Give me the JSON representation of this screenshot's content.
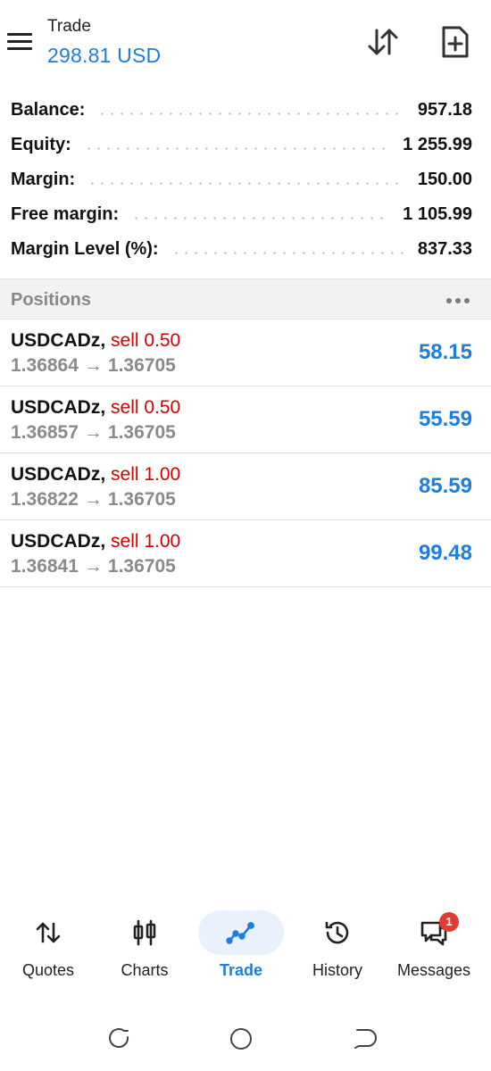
{
  "header": {
    "title": "Trade",
    "subtitle": "298.81 USD",
    "menu_icon": "hamburger-menu-icon",
    "sort_icon": "sort-arrows-icon",
    "new_order_icon": "new-order-document-icon"
  },
  "summary": [
    {
      "label": "Balance:",
      "value": "957.18"
    },
    {
      "label": "Equity:",
      "value": "1 255.99"
    },
    {
      "label": "Margin:",
      "value": "150.00"
    },
    {
      "label": "Free margin:",
      "value": "1 105.99"
    },
    {
      "label": "Margin Level (%):",
      "value": "837.33"
    }
  ],
  "positions": {
    "title": "Positions",
    "more_icon": "more-dots-icon",
    "items": [
      {
        "symbol": "USDCADz",
        "side": "sell 0.50",
        "open": "1.36864",
        "arrow": "→",
        "current": "1.36705",
        "profit": "58.15"
      },
      {
        "symbol": "USDCADz",
        "side": "sell 0.50",
        "open": "1.36857",
        "arrow": "→",
        "current": "1.36705",
        "profit": "55.59"
      },
      {
        "symbol": "USDCADz",
        "side": "sell 1.00",
        "open": "1.36822",
        "arrow": "→",
        "current": "1.36705",
        "profit": "85.59"
      },
      {
        "symbol": "USDCADz",
        "side": "sell 1.00",
        "open": "1.36841",
        "arrow": "→",
        "current": "1.36705",
        "profit": "99.48"
      }
    ]
  },
  "bottom_nav": {
    "items": [
      {
        "label": "Quotes",
        "icon": "quotes-arrows-icon",
        "active": false
      },
      {
        "label": "Charts",
        "icon": "candlestick-chart-icon",
        "active": false
      },
      {
        "label": "Trade",
        "icon": "trade-line-icon",
        "active": true
      },
      {
        "label": "History",
        "icon": "history-clock-icon",
        "active": false
      },
      {
        "label": "Messages",
        "icon": "messages-chat-icon",
        "active": false,
        "badge": "1"
      }
    ]
  },
  "colors": {
    "accent": "#1e7de0",
    "sell": "#d40000",
    "badge": "#e53935"
  }
}
